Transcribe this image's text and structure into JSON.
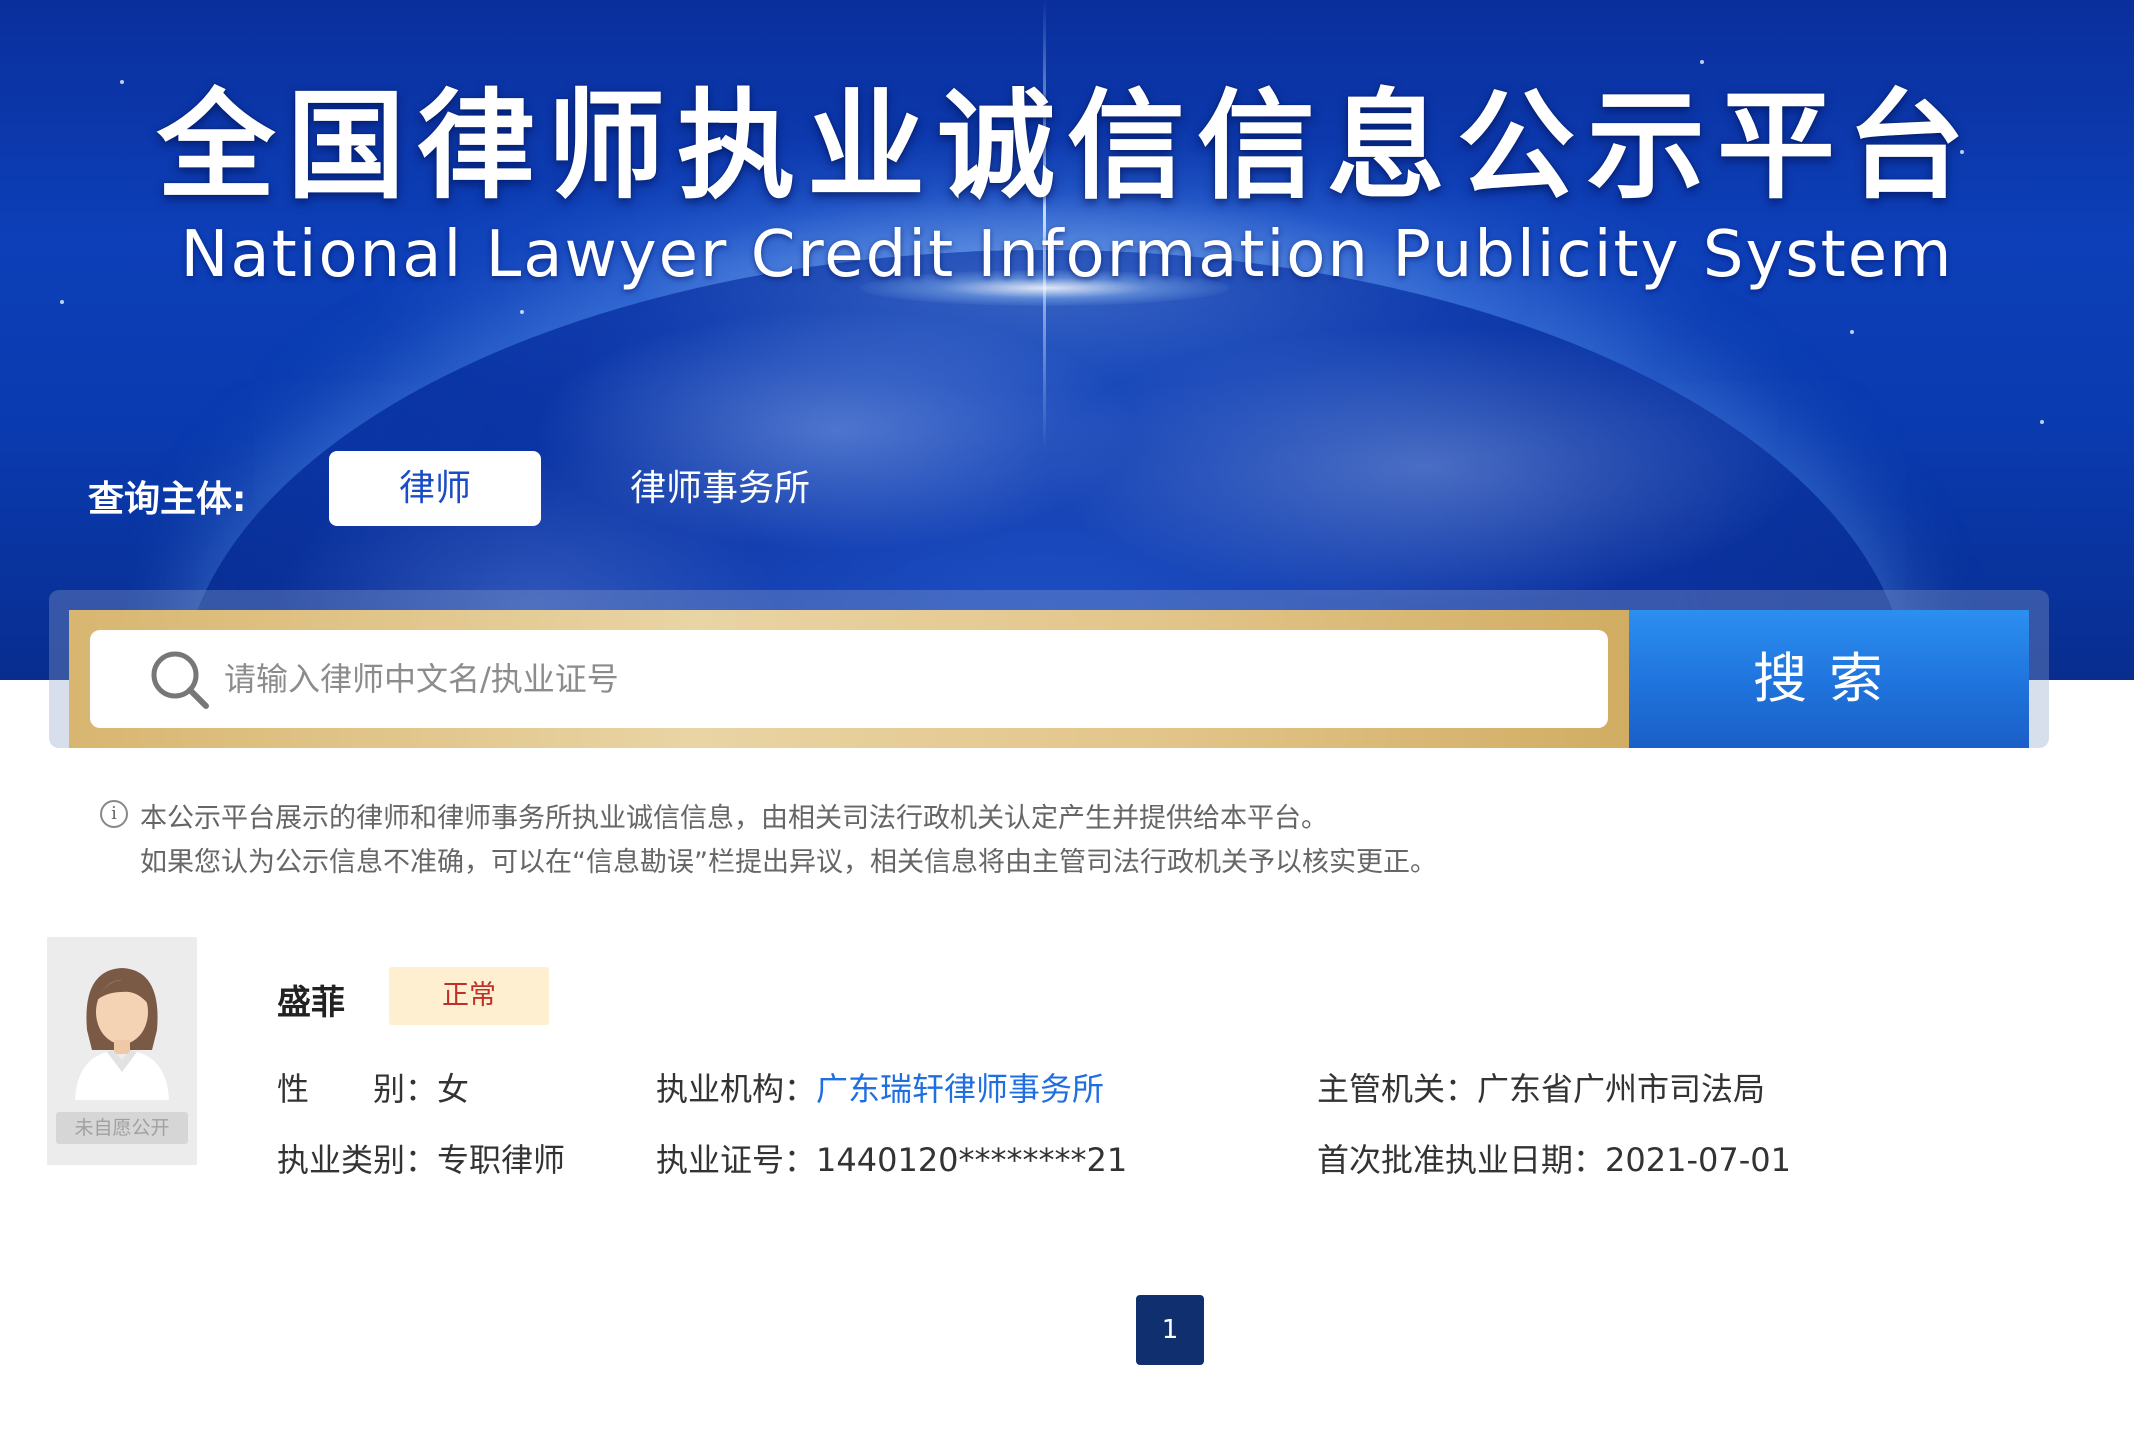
{
  "banner": {
    "title_cn": "全国律师执业诚信信息公示平台",
    "title_en": "National Lawyer Credit Information Publicity System"
  },
  "query": {
    "label": "查询主体:",
    "tabs": [
      {
        "label": "律师",
        "active": true
      },
      {
        "label": "律师事务所",
        "active": false
      }
    ]
  },
  "search": {
    "placeholder": "请输入律师中文名/执业证号",
    "value": "",
    "button_label": "搜索"
  },
  "notice": {
    "icon": "info-icon",
    "line1": "本公示平台展示的律师和律师事务所执业诚信信息，由相关司法行政机关认定产生并提供给本平台。",
    "line2": "如果您认为公示信息不准确，可以在“信息勘误”栏提出异议，相关信息将由主管司法行政机关予以核实更正。"
  },
  "result": {
    "avatar_tag": "未自愿公开",
    "name": "盛菲",
    "status": "正常",
    "gender_label": "性　　别：",
    "gender": "女",
    "org_label": "执业机构：",
    "org": "广东瑞轩律师事务所",
    "authority_label": "主管机关：",
    "authority": "广东省广州市司法局",
    "category_label": "执业类别：",
    "category": "专职律师",
    "license_label": "执业证号：",
    "license": "1440120********21",
    "first_date_label": "首次批准执业日期：",
    "first_date": "2021-07-01"
  },
  "pagination": {
    "current": "1"
  },
  "colors": {
    "banner_blue": "#0d3fb8",
    "search_button": "#1f73dc",
    "gold": "#e2c58a",
    "link": "#1f6fe0",
    "status_bg": "#fdefcf",
    "status_text": "#c0302a",
    "page_active": "#0f2f6e"
  }
}
